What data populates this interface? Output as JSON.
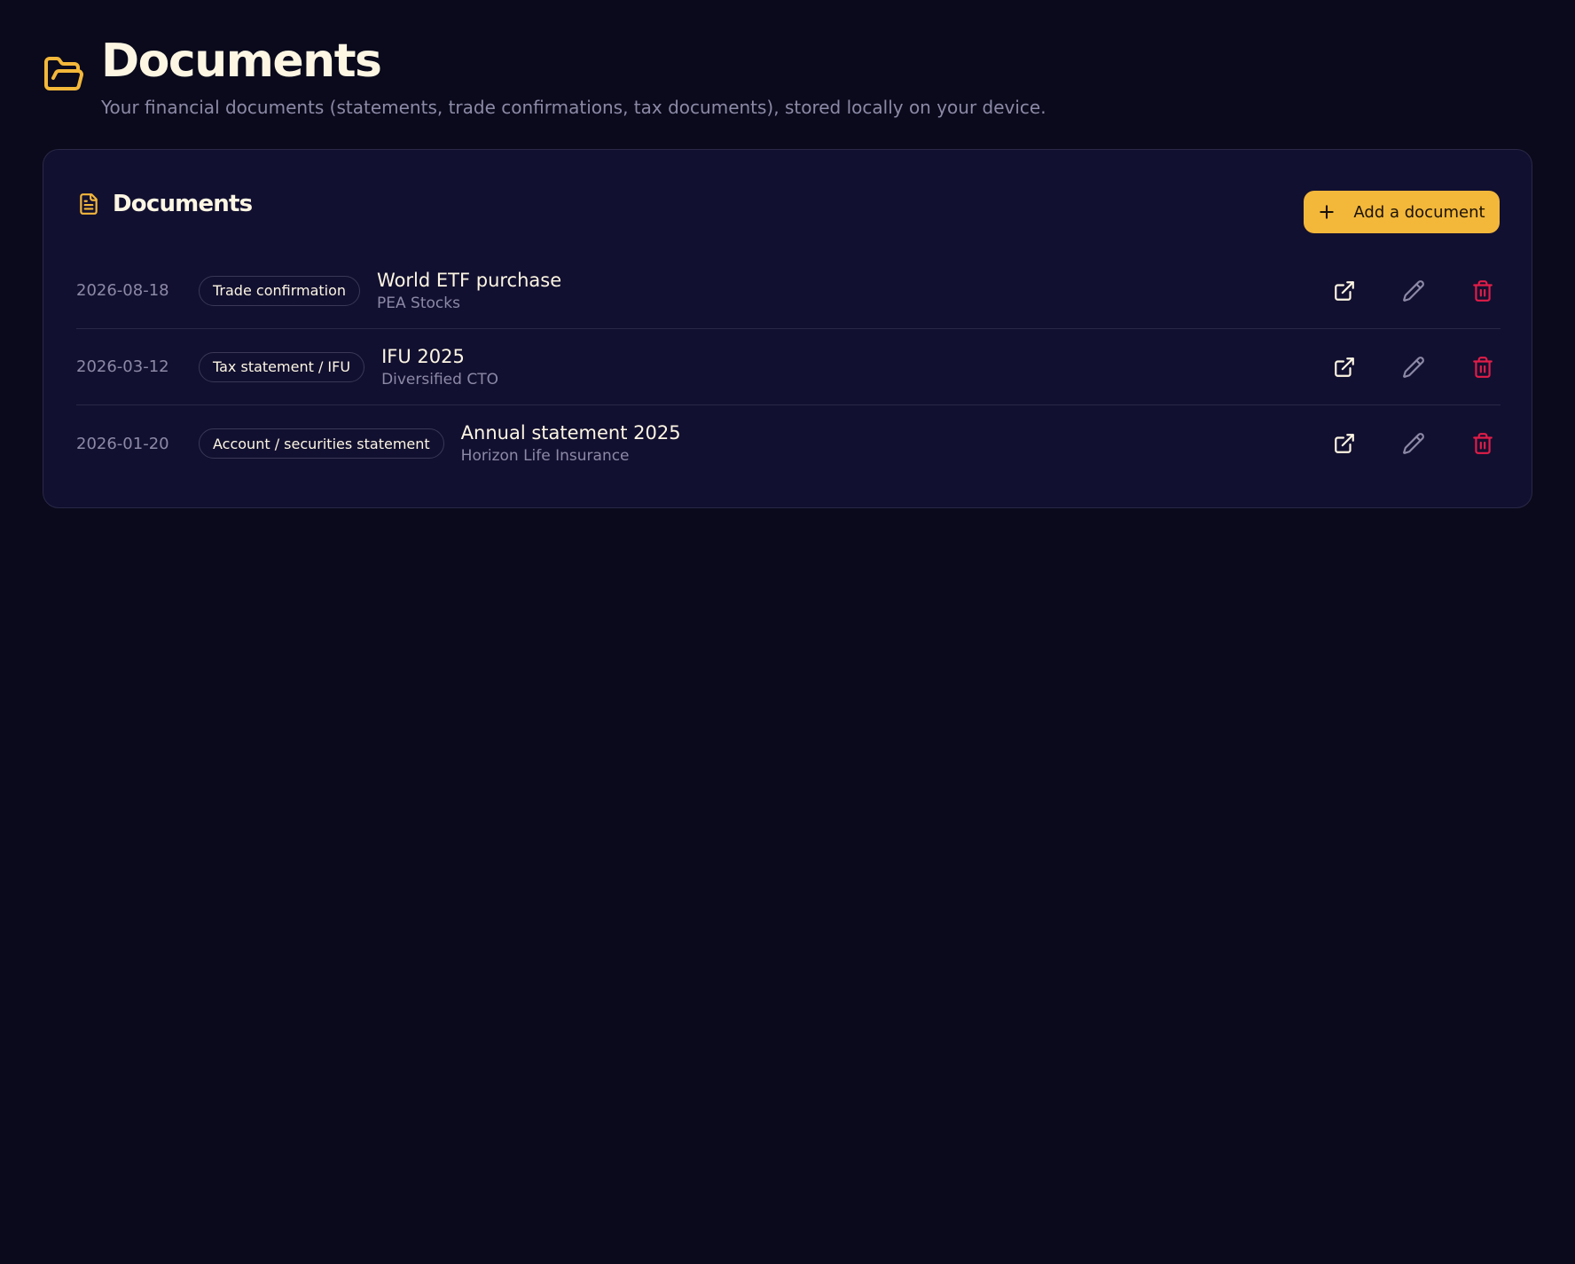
{
  "header": {
    "title": "Documents",
    "subtitle": "Your financial documents (statements, trade confirmations, tax documents), stored locally on your device.",
    "icon": "folder-open-icon"
  },
  "card": {
    "title": "Documents",
    "icon": "file-text-icon",
    "add_button_label": "Add a document"
  },
  "documents": [
    {
      "date": "2026-08-18",
      "type": "Trade confirmation",
      "name": "World ETF purchase",
      "account": "PEA Stocks"
    },
    {
      "date": "2026-03-12",
      "type": "Tax statement / IFU",
      "name": "IFU 2025",
      "account": "Diversified CTO"
    },
    {
      "date": "2026-01-20",
      "type": "Account / securities statement",
      "name": "Annual statement 2025",
      "account": "Horizon Life Insurance"
    }
  ],
  "colors": {
    "background": "#0a0a1c",
    "card": "#121030",
    "accent": "#f3b73a",
    "delete": "#e11d48",
    "muted_text": "#8c89a6"
  }
}
